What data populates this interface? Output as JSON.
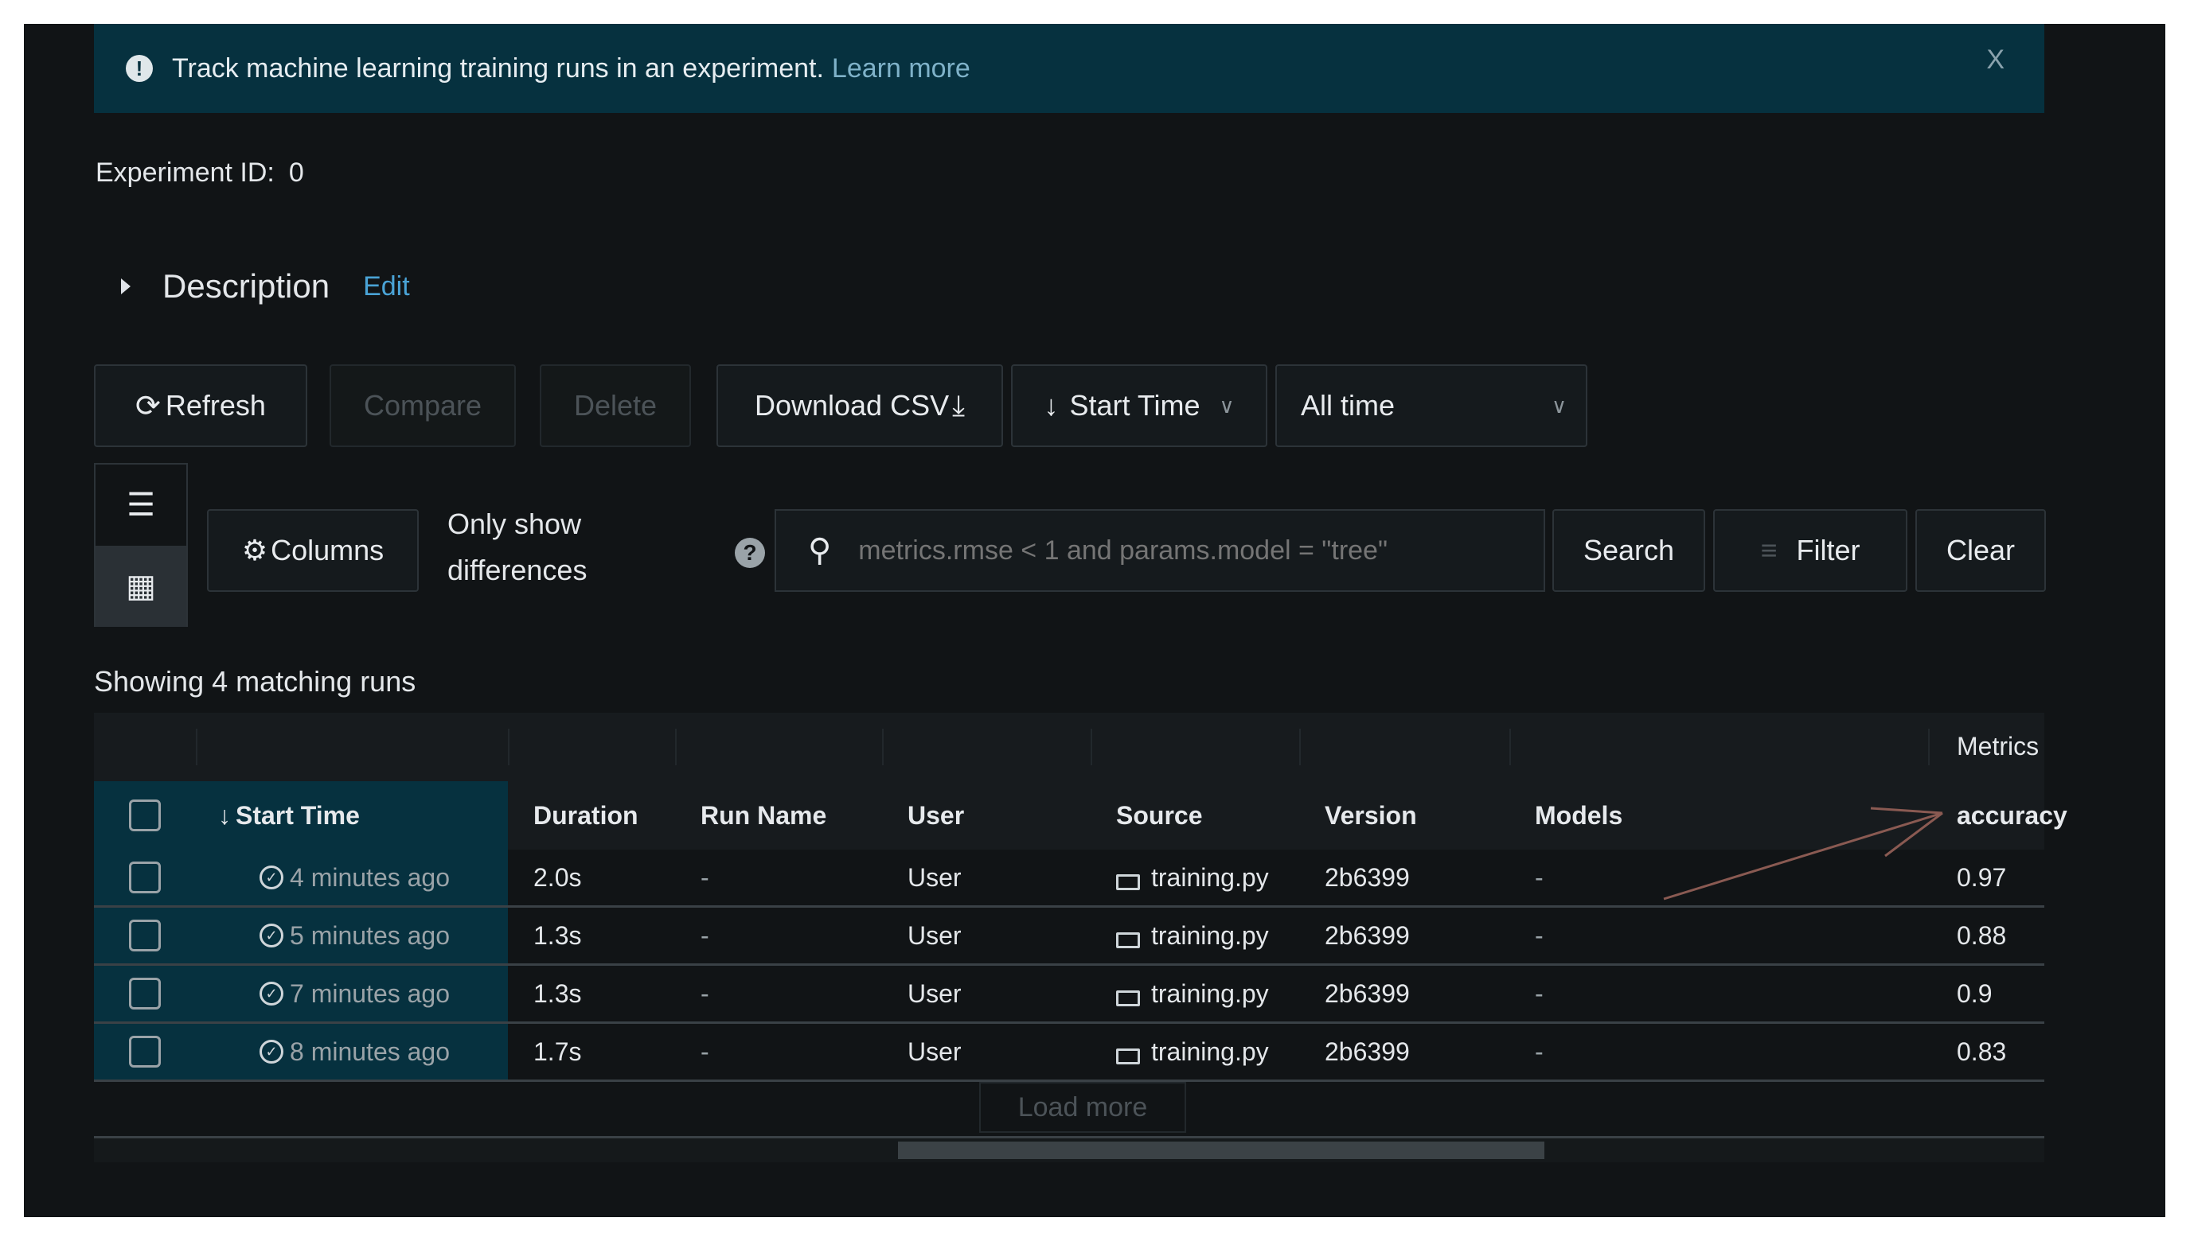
{
  "banner": {
    "text": "Track machine learning training runs in an experiment.",
    "link": "Learn more",
    "close": "X"
  },
  "experiment": {
    "label": "Experiment ID:",
    "value": "0"
  },
  "description": {
    "label": "Description",
    "edit": "Edit"
  },
  "toolbar": {
    "refresh": "Refresh",
    "compare": "Compare",
    "delete": "Delete",
    "download": "Download CSV",
    "sort": "Start Time",
    "time_range": "All time"
  },
  "filters": {
    "columns": "Columns",
    "only_show_line1": "Only show",
    "only_show_line2": "differences",
    "search_placeholder": "metrics.rmse < 1 and params.model = \"tree\"",
    "search": "Search",
    "filter": "Filter",
    "clear": "Clear"
  },
  "showing": "Showing 4 matching runs",
  "table": {
    "group_metrics": "Metrics",
    "headers": {
      "start_time": "Start Time",
      "duration": "Duration",
      "run_name": "Run Name",
      "user": "User",
      "source": "Source",
      "version": "Version",
      "models": "Models",
      "accuracy": "accuracy"
    },
    "rows": [
      {
        "start_time": "4 minutes ago",
        "duration": "2.0s",
        "run_name": "-",
        "user": "User",
        "source": "training.py",
        "version": "2b6399",
        "models": "-",
        "accuracy": "0.97"
      },
      {
        "start_time": "5 minutes ago",
        "duration": "1.3s",
        "run_name": "-",
        "user": "User",
        "source": "training.py",
        "version": "2b6399",
        "models": "-",
        "accuracy": "0.88"
      },
      {
        "start_time": "7 minutes ago",
        "duration": "1.3s",
        "run_name": "-",
        "user": "User",
        "source": "training.py",
        "version": "2b6399",
        "models": "-",
        "accuracy": "0.9"
      },
      {
        "start_time": "8 minutes ago",
        "duration": "1.7s",
        "run_name": "-",
        "user": "User",
        "source": "training.py",
        "version": "2b6399",
        "models": "-",
        "accuracy": "0.83"
      }
    ]
  },
  "load_more": "Load more",
  "colors": {
    "banner_bg": "#06313f",
    "link": "#4aa3d6",
    "app_bg": "#111416"
  },
  "icons": [
    "info-icon",
    "close-icon",
    "caret-right-icon",
    "refresh-icon",
    "download-icon",
    "arrow-down-icon",
    "chevron-down-icon",
    "list-view-icon",
    "table-view-icon",
    "gear-icon",
    "help-icon",
    "search-icon",
    "filter-icon",
    "check-circle-icon",
    "laptop-icon",
    "sort-arrow-icon"
  ]
}
